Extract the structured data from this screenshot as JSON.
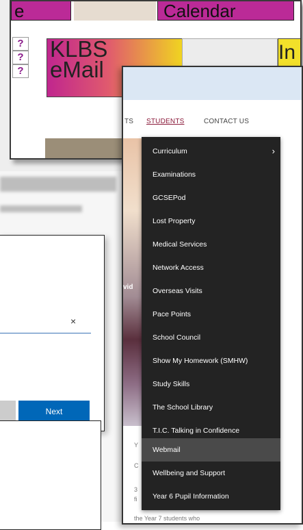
{
  "back_site": {
    "calendar_partial": "e",
    "calendar_label": "Calendar",
    "question_marks": [
      "?",
      "?",
      "?"
    ],
    "email_tile": [
      "KLBS",
      "eMail"
    ],
    "right_tile_partial": "In"
  },
  "signin_dialog": {
    "close_glyph": "×",
    "next_label": "Next"
  },
  "school_site": {
    "nav": {
      "partial": "TS",
      "students": "STUDENTS",
      "contact": "CONTACT US"
    },
    "hero_partial": "vid",
    "students_menu": [
      {
        "label": "Curriculum",
        "has_submenu": true
      },
      {
        "label": "Examinations"
      },
      {
        "label": "GCSEPod"
      },
      {
        "label": "Lost Property"
      },
      {
        "label": "Medical Services"
      },
      {
        "label": "Network Access"
      },
      {
        "label": "Overseas Visits"
      },
      {
        "label": "Pace Points"
      },
      {
        "label": "School Council"
      },
      {
        "label": "Show My Homework (SMHW)"
      },
      {
        "label": "Study Skills"
      },
      {
        "label": "The School Library"
      },
      {
        "label": "T.I.C. Talking in Confidence"
      },
      {
        "label": "Webmail",
        "highlighted": true
      },
      {
        "label": "Wellbeing and Support"
      },
      {
        "label": "Year 6 Pupil Information"
      }
    ],
    "submenu_glyph": "›",
    "below_text": "the Year 7 students who"
  }
}
